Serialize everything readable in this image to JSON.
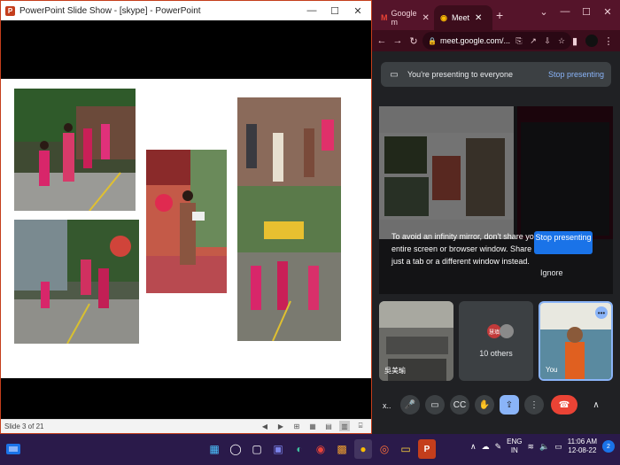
{
  "powerpoint": {
    "window_title": "PowerPoint Slide Show - [skype] - PowerPoint",
    "logo_letter": "P",
    "controls": {
      "minimize": "—",
      "restore": "☐",
      "close": "✕"
    },
    "status": {
      "slide_indicator": "Slide 3 of 21",
      "icons": [
        "◀",
        "▶",
        "⊞",
        "▦",
        "▤",
        "▥",
        "⌸"
      ]
    }
  },
  "chrome": {
    "tabs": [
      {
        "favicon": "M",
        "title": "Google m",
        "close": "✕"
      },
      {
        "favicon": "◉",
        "title": "Meet",
        "close": "✕"
      }
    ],
    "new_tab": "+",
    "controls": {
      "collapse": "⌄",
      "minimize": "—",
      "restore": "☐",
      "close": "✕"
    },
    "nav": {
      "back": "←",
      "forward": "→",
      "reload": "↻"
    },
    "omnibox": {
      "lock": "🔒",
      "url": "meet.google.com/..."
    },
    "omni_icons": [
      "⎘",
      "↗",
      "⇩",
      "☆"
    ],
    "right_icons": {
      "sidepanel": "▮",
      "menu": "⋮"
    }
  },
  "meet": {
    "banner": {
      "icon": "▭",
      "message": "You're presenting to everyone",
      "stop_label": "Stop presenting"
    },
    "warning_text": "To avoid an infinity mirror, don't share your entire screen or browser window. Share just a tab or a different window instead.",
    "stop_button": "Stop presenting",
    "ignore_label": "Ignore",
    "tiles": [
      {
        "name": "吳美瑜"
      },
      {
        "name": "10 others",
        "avatars": [
          "慧瑱",
          ""
        ]
      },
      {
        "name": "You",
        "more": "•••"
      }
    ],
    "controls": {
      "meeting_code": "x..",
      "mic": "🎤",
      "camera": "▭",
      "captions": "CC",
      "raise_hand": "✋",
      "present": "⇪",
      "more": "⋮",
      "leave": "☎",
      "expand": "∧"
    }
  },
  "taskbar": {
    "apps": [
      "▦",
      "◯",
      "▢",
      "▣",
      "◐",
      "◉",
      "▩",
      "●",
      "◎",
      "▭",
      "P"
    ],
    "tray": {
      "chevron": "∧",
      "cloud": "☁",
      "pen": "✎",
      "lang_top": "ENG",
      "lang_bottom": "IN",
      "wifi": "≋",
      "volume": "🔈",
      "battery": "▭",
      "time": "11:06 AM",
      "date": "12-08-22",
      "notifications": "2"
    }
  }
}
